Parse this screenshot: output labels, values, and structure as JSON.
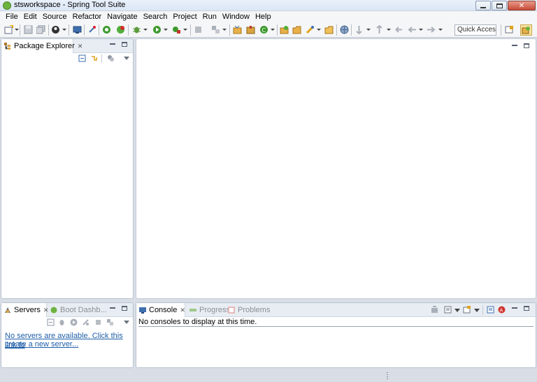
{
  "window": {
    "title": "stsworkspace - Spring Tool Suite",
    "controls": {
      "close_label": "✕"
    }
  },
  "menu": [
    "File",
    "Edit",
    "Source",
    "Refactor",
    "Navigate",
    "Search",
    "Project",
    "Run",
    "Window",
    "Help"
  ],
  "toolbar": {
    "quick_access_placeholder": "Quick Access"
  },
  "package_explorer": {
    "tab_label": "Package Explorer",
    "close_glyph": "✕"
  },
  "servers_view": {
    "tabs": [
      {
        "label": "Servers",
        "active": true,
        "close_glyph": "✕"
      },
      {
        "label": "Boot Dashb...",
        "active": false
      }
    ],
    "empty_link_line1": "No servers are available. Click this link to",
    "empty_link_line2": "create a new server..."
  },
  "console_view": {
    "tabs": [
      {
        "label": "Console",
        "active": true,
        "close_glyph": "✕"
      },
      {
        "label": "Progress",
        "active": false
      },
      {
        "label": "Problems",
        "active": false
      }
    ],
    "message": "No consoles to display at this time."
  },
  "colors": {
    "spring_green": "#6db33f",
    "link_blue": "#1f5ea8",
    "panel_header": "#e8edf3",
    "workbench_bg": "#d9dee6"
  },
  "icons": [
    "new-wizard-icon",
    "save-icon",
    "save-all-icon",
    "boot-icon",
    "console-icon",
    "pin-icon",
    "start-server-icon",
    "relaunch-icon",
    "debug-icon",
    "run-icon",
    "external-tools-icon",
    "stop-icon",
    "open-type-icon",
    "new-package-icon",
    "new-class-icon",
    "new-java-project-icon",
    "open-resource-icon",
    "search-icon",
    "globe-icon",
    "next-annotation-icon",
    "prev-annotation-icon",
    "back-icon",
    "forward-icon",
    "open-perspective-icon",
    "spring-perspective-icon"
  ]
}
